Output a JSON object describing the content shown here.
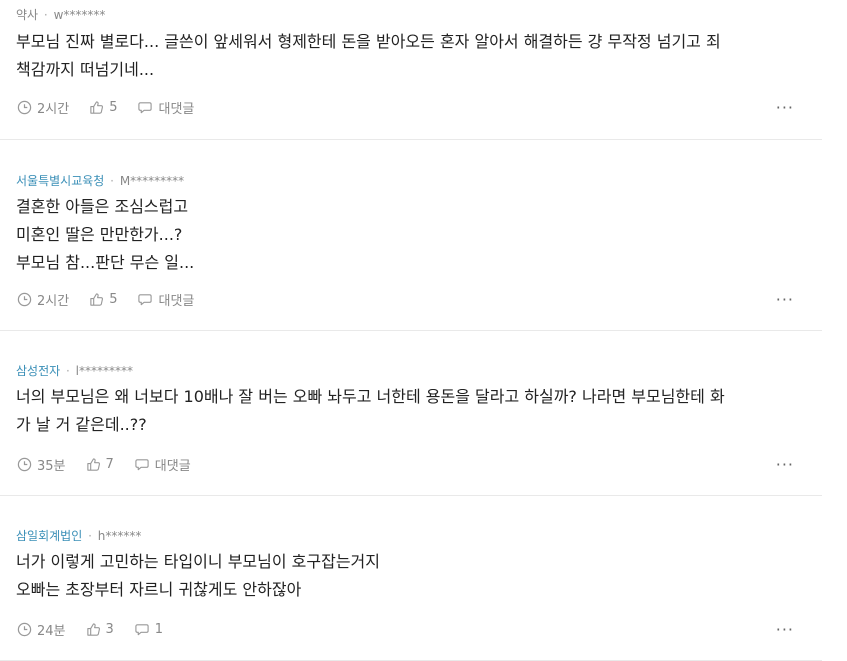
{
  "comments": [
    {
      "company": "약사",
      "separator": "·",
      "user": "w*******",
      "text": "부모님 진짜 별로다... 글쓴이 앞세워서 형제한테 돈을 받아오든 혼자 알아서 해결하든 걍 무작정 넘기고 죄\n책감까지 떠넘기네...",
      "time": "2시간",
      "likes": "5",
      "reply": "대댓글",
      "more": "···"
    },
    {
      "company": "서울특별시교육청",
      "separator": "·",
      "user": "M*********",
      "text": "결혼한 아들은 조심스럽고\n미혼인 딸은 만만한가...?\n부모님 참...판단 무슨 일...",
      "time": "2시간",
      "likes": "5",
      "reply": "대댓글",
      "more": "···"
    },
    {
      "company": "삼성전자",
      "separator": "·",
      "user": "l*********",
      "text": "너의 부모님은 왜 너보다 10배나 잘 버는 오빠 놔두고 너한테 용돈을 달라고 하실까? 나라면 부모님한테 화\n가 날 거 같은데..??",
      "time": "35분",
      "likes": "7",
      "reply": "대댓글",
      "more": "···"
    },
    {
      "company": "삼일회계법인",
      "separator": "·",
      "user": "h******",
      "text": "너가 이렇게 고민하는 타입이니 부모님이 호구잡는거지\n오빠는 초장부터 자르니 귀찮게도 안하잖아",
      "time": "24분",
      "likes": "3",
      "reply": "1",
      "more": "···"
    }
  ],
  "icons": {
    "time": "clock-icon",
    "like": "thumbs-up-icon",
    "reply": "speech-bubble-icon",
    "more": "more-dots-icon"
  },
  "colors": {
    "company": "#3a8fb7",
    "meta": "#888888",
    "text": "#222222",
    "divider": "#e9e9e9"
  }
}
